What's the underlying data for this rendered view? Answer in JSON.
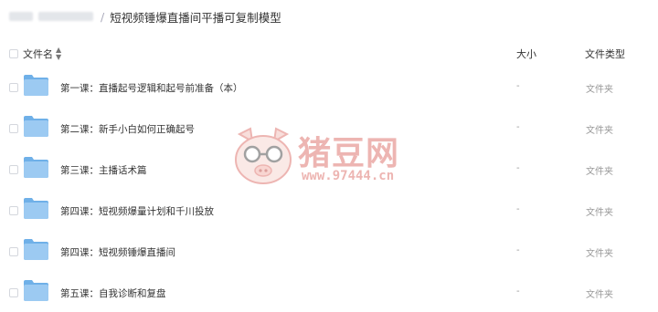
{
  "breadcrumb": {
    "separator": "/",
    "current": "短视频锤爆直播间平播可复制模型"
  },
  "table": {
    "columns": {
      "name": "文件名",
      "size": "大小",
      "type": "文件类型"
    },
    "rows": [
      {
        "name": "第一课：直播起号逻辑和起号前准备（本）",
        "size": "-",
        "type": "文件夹",
        "icon": "folder-icon"
      },
      {
        "name": "第二课：新手小白如何正确起号",
        "size": "-",
        "type": "文件夹",
        "icon": "folder-icon"
      },
      {
        "name": "第三课：主播话术篇",
        "size": "-",
        "type": "文件夹",
        "icon": "folder-icon"
      },
      {
        "name": "第四课：短视频爆量计划和千川投放",
        "size": "-",
        "type": "文件夹",
        "icon": "folder-icon"
      },
      {
        "name": "第四课：短视频锤爆直播间",
        "size": "-",
        "type": "文件夹",
        "icon": "folder-icon"
      },
      {
        "name": "第五课：自我诊断和复盘",
        "size": "-",
        "type": "文件夹",
        "icon": "folder-icon"
      }
    ]
  },
  "watermark": {
    "title": "猪豆网",
    "url": "www.97444.cn",
    "icon": "pig-with-glasses-logo",
    "color": "#e07a74"
  },
  "colors": {
    "folder": "#8fc3ef",
    "folder_dark": "#6fb0e8"
  }
}
